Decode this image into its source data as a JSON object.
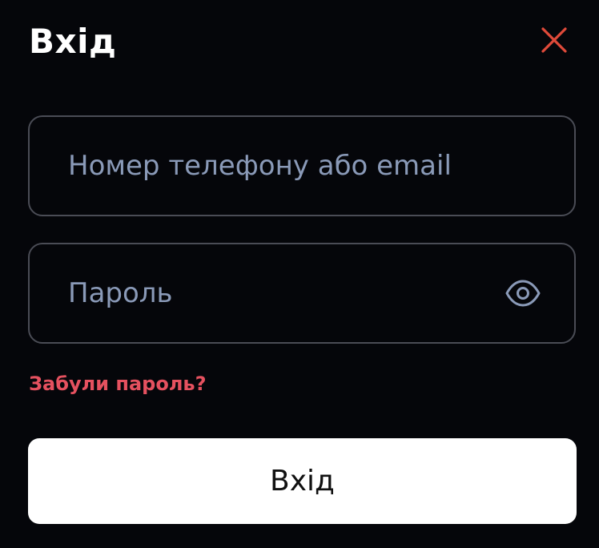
{
  "modal": {
    "title": "Вхід"
  },
  "login_field": {
    "value": "",
    "placeholder": "Номер телефону або email"
  },
  "password_field": {
    "value": "",
    "placeholder": "Пароль"
  },
  "forgot_link": {
    "label": "Забули пароль?"
  },
  "submit_button": {
    "label": "Вхід"
  },
  "icons": {
    "close": "close-icon",
    "show_password": "eye-icon"
  },
  "colors": {
    "background": "#05060a",
    "accent_red": "#e5515f",
    "close_icon": "#e04a3a",
    "field_border": "#4a4c55",
    "placeholder": "#8a9ab8",
    "button_bg": "#ffffff"
  }
}
